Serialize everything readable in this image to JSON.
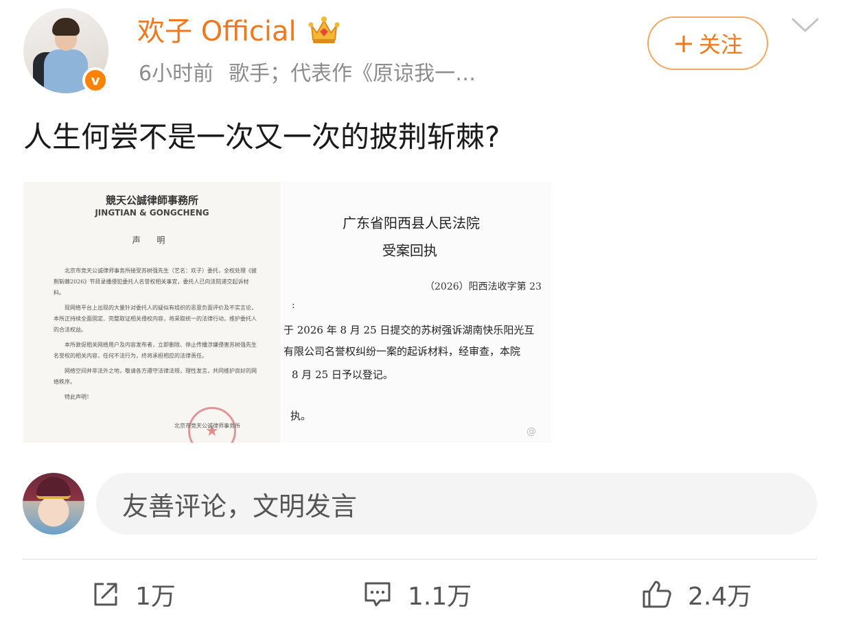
{
  "author": {
    "name": "欢子 Official",
    "time": "6小时前",
    "description": "歌手；代表作《原谅我一…",
    "badge": "v",
    "accent_color": "#f0781e"
  },
  "follow_button": {
    "plus": "+",
    "label": "关注"
  },
  "post": {
    "text": "人生何尝不是一次又一次的披荆斩棘?"
  },
  "image_left": {
    "firm_name": "競天公誠律師事務所",
    "firm_name_en": "JINGTIAN & GONGCHENG",
    "title": "声 明",
    "paragraphs": [
      "北京市竞天公诚律师事务所接受苏树强先生（艺名：欢子）委托，全权处理《披荆斩棘2026》节目录播侵犯委托人名誉权相关事宜，委托人已向法院递交起诉材料。",
      "现网络平台上出现的大量针对委托人的疑似有组织的恶意负面评价及不实言论，本所正持续全面固定、完整取证相关侵权内容，将采取统一的法律行动，维护委托人的合法权益。",
      "本所敦促相关网络用户及内容发布者，立即删除、停止传播涉嫌侵害苏树强先生名誉权的相关内容，任何不法行为，终将承担相应的法律责任。",
      "网络空间并非法外之地，敬请各方遵守法律法规，理性发言，共同维护良好的网络秩序。",
      "特此声明！"
    ],
    "signature": "北京市竞天公诚律师事务所"
  },
  "image_right": {
    "court": "广东省阳西县人民法院",
    "title": "受案回执",
    "case_no": "（2026）阳西法收字第 23",
    "colon": ":",
    "lines": [
      "于 2026 年 8 月 25 日提交的苏树强诉湖南快乐阳光互",
      "有限公司名誉权纠纷一案的起诉材料，经审查，本院",
      "8 月 25 日予以登记。",
      "执。"
    ],
    "watermark": "@"
  },
  "comment_box": {
    "placeholder": "友善评论，文明发言"
  },
  "actions": {
    "share_count": "1万",
    "comment_count": "1.1万",
    "like_count": "2.4万"
  }
}
